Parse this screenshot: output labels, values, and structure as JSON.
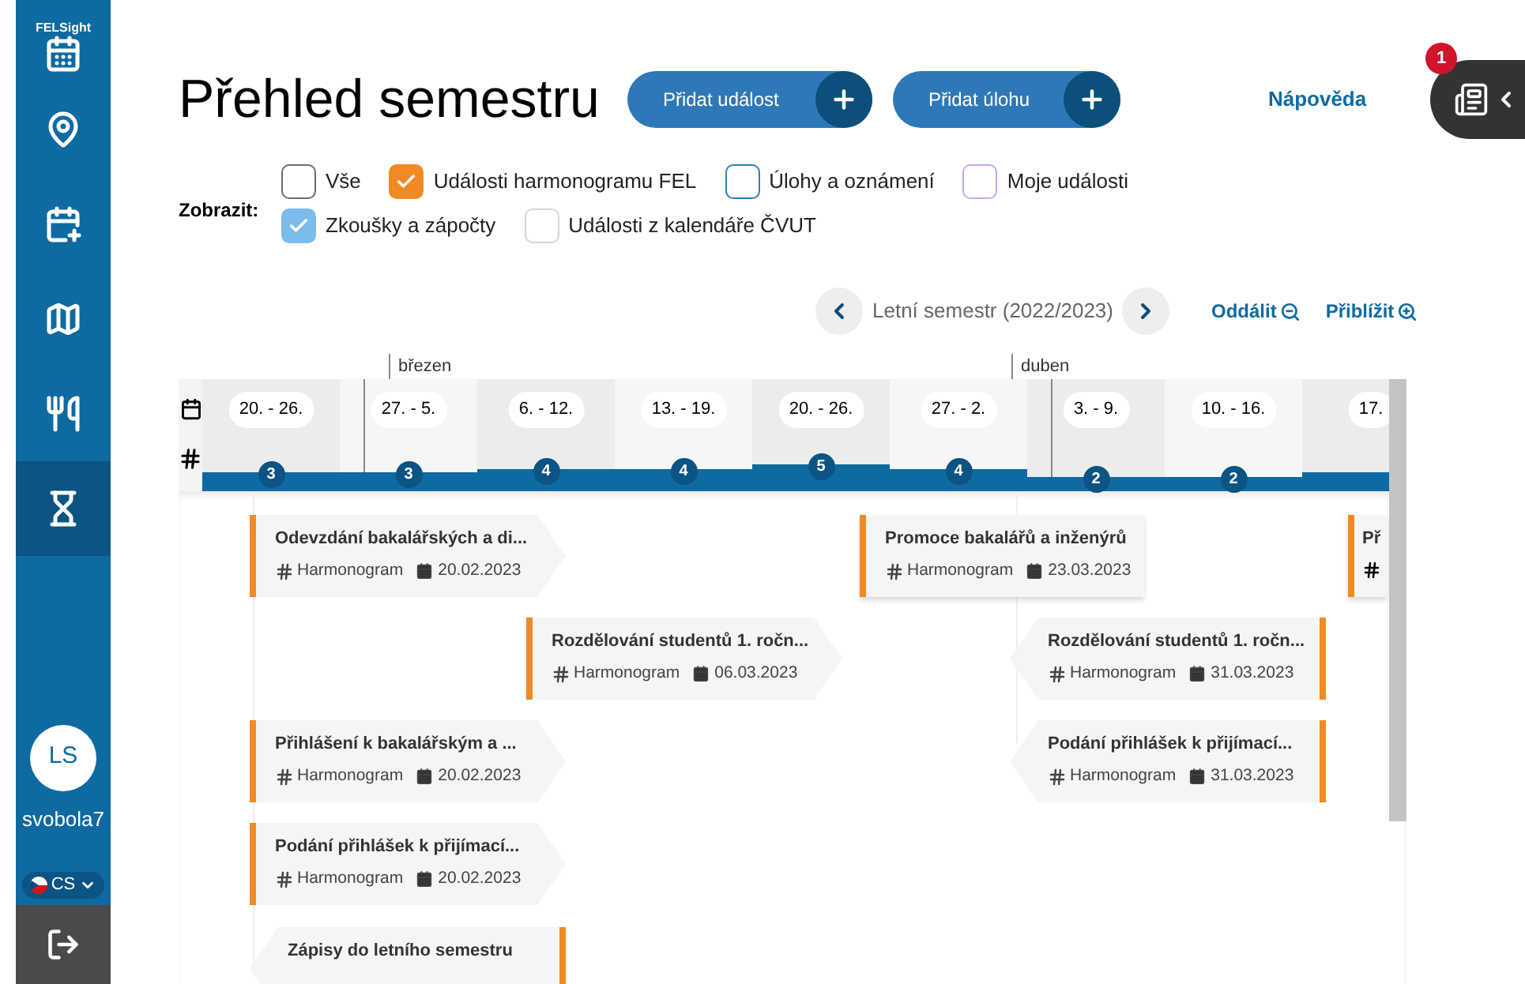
{
  "sidebar": {
    "brand": "FELSight",
    "items": [
      {
        "selected": false
      },
      {
        "selected": false
      },
      {
        "selected": false
      },
      {
        "selected": false
      },
      {
        "selected": false
      },
      {
        "selected": true
      }
    ],
    "user": {
      "initials": "LS",
      "name": "svobola7"
    },
    "language": "CS"
  },
  "header": {
    "title": "Přehled semestru",
    "buttons": [
      "Přidat událost",
      "Přidat úlohu"
    ],
    "help": "Nápověda",
    "notifications": "1"
  },
  "filters": {
    "label": "Zobrazit:",
    "options": [
      {
        "label": "Vše",
        "checked": false,
        "color": "#6b6b6b"
      },
      {
        "label": "Události harmonogramu FEL",
        "checked": true,
        "color": "#f08a24"
      },
      {
        "label": "Úlohy a oznámení",
        "checked": false,
        "color": "#2f7fb0"
      },
      {
        "label": "Moje události",
        "checked": false,
        "color": "#c9a8f0"
      },
      {
        "label": "Zkoušky a zápočty",
        "checked": true,
        "color": "#7cbcec"
      },
      {
        "label": "Události z kalendáře ČVUT",
        "checked": false,
        "color": "#d6d6d6"
      }
    ]
  },
  "semester": {
    "label": "Letní semestr (2022/2023)",
    "zoom_out": "Oddálit",
    "zoom_in": "Přiblížit"
  },
  "timeline": {
    "months": [
      "březen",
      "duben"
    ],
    "weeks": [
      {
        "range": "20. - 26.",
        "count": "3"
      },
      {
        "range": "27. - 5.",
        "count": "3"
      },
      {
        "range": "6. - 12.",
        "count": "4"
      },
      {
        "range": "13. - 19.",
        "count": "4"
      },
      {
        "range": "20. - 26.",
        "count": "5"
      },
      {
        "range": "27. - 2.",
        "count": "4"
      },
      {
        "range": "3. - 9.",
        "count": "2"
      },
      {
        "range": "10. - 16.",
        "count": "2"
      },
      {
        "range": "17."
      }
    ],
    "events": [
      {
        "title": "Odevzdání bakalářských a di...",
        "tag": "Harmonogram",
        "date": "20.02.2023"
      },
      {
        "title": "Promoce bakalářů a inženýrů",
        "tag": "Harmonogram",
        "date": "23.03.2023"
      },
      {
        "title": "Př"
      },
      {
        "title": "Rozdělování studentů 1. ročn...",
        "tag": "Harmonogram",
        "date": "06.03.2023"
      },
      {
        "title": "Rozdělování studentů 1. ročn...",
        "tag": "Harmonogram",
        "date": "31.03.2023"
      },
      {
        "title": "Přihlášení k bakalářským a ...",
        "tag": "Harmonogram",
        "date": "20.02.2023"
      },
      {
        "title": "Podání přihlášek k přijímací...",
        "tag": "Harmonogram",
        "date": "31.03.2023"
      },
      {
        "title": "Podání přihlášek k přijímací...",
        "tag": "Harmonogram",
        "date": "20.02.2023"
      },
      {
        "title": "Zápisy do letního semestru"
      }
    ]
  }
}
